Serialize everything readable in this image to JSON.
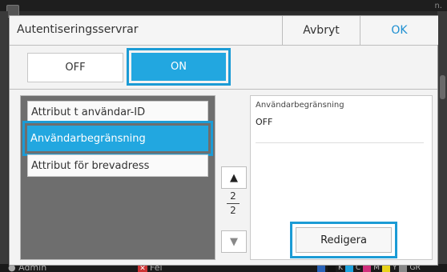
{
  "background": {
    "user_label": "Admin",
    "error_label": "Fel",
    "corner_text": "n.",
    "ink_labels": [
      "K",
      "C",
      "M",
      "Y",
      "GR"
    ],
    "ink_colors": [
      "#111111",
      "#1fa3dd",
      "#d0307c",
      "#e7d21a",
      "#888888"
    ]
  },
  "dialog": {
    "title": "Autentiseringsservrar",
    "cancel_label": "Avbryt",
    "ok_label": "OK",
    "toggle": {
      "off_label": "OFF",
      "on_label": "ON",
      "selected": "ON"
    },
    "list": {
      "items": [
        {
          "label": "Attribut t användar-ID",
          "selected": false
        },
        {
          "label": "Användarbegränsning",
          "selected": true
        },
        {
          "label": "Attribut för brevadress",
          "selected": false
        }
      ]
    },
    "pager": {
      "current": "2",
      "total": "2"
    },
    "detail": {
      "label": "Användarbegränsning",
      "value": "OFF",
      "edit_label": "Redigera"
    }
  },
  "colors": {
    "accent": "#22a7e0",
    "ok_text": "#1d8fd1"
  }
}
